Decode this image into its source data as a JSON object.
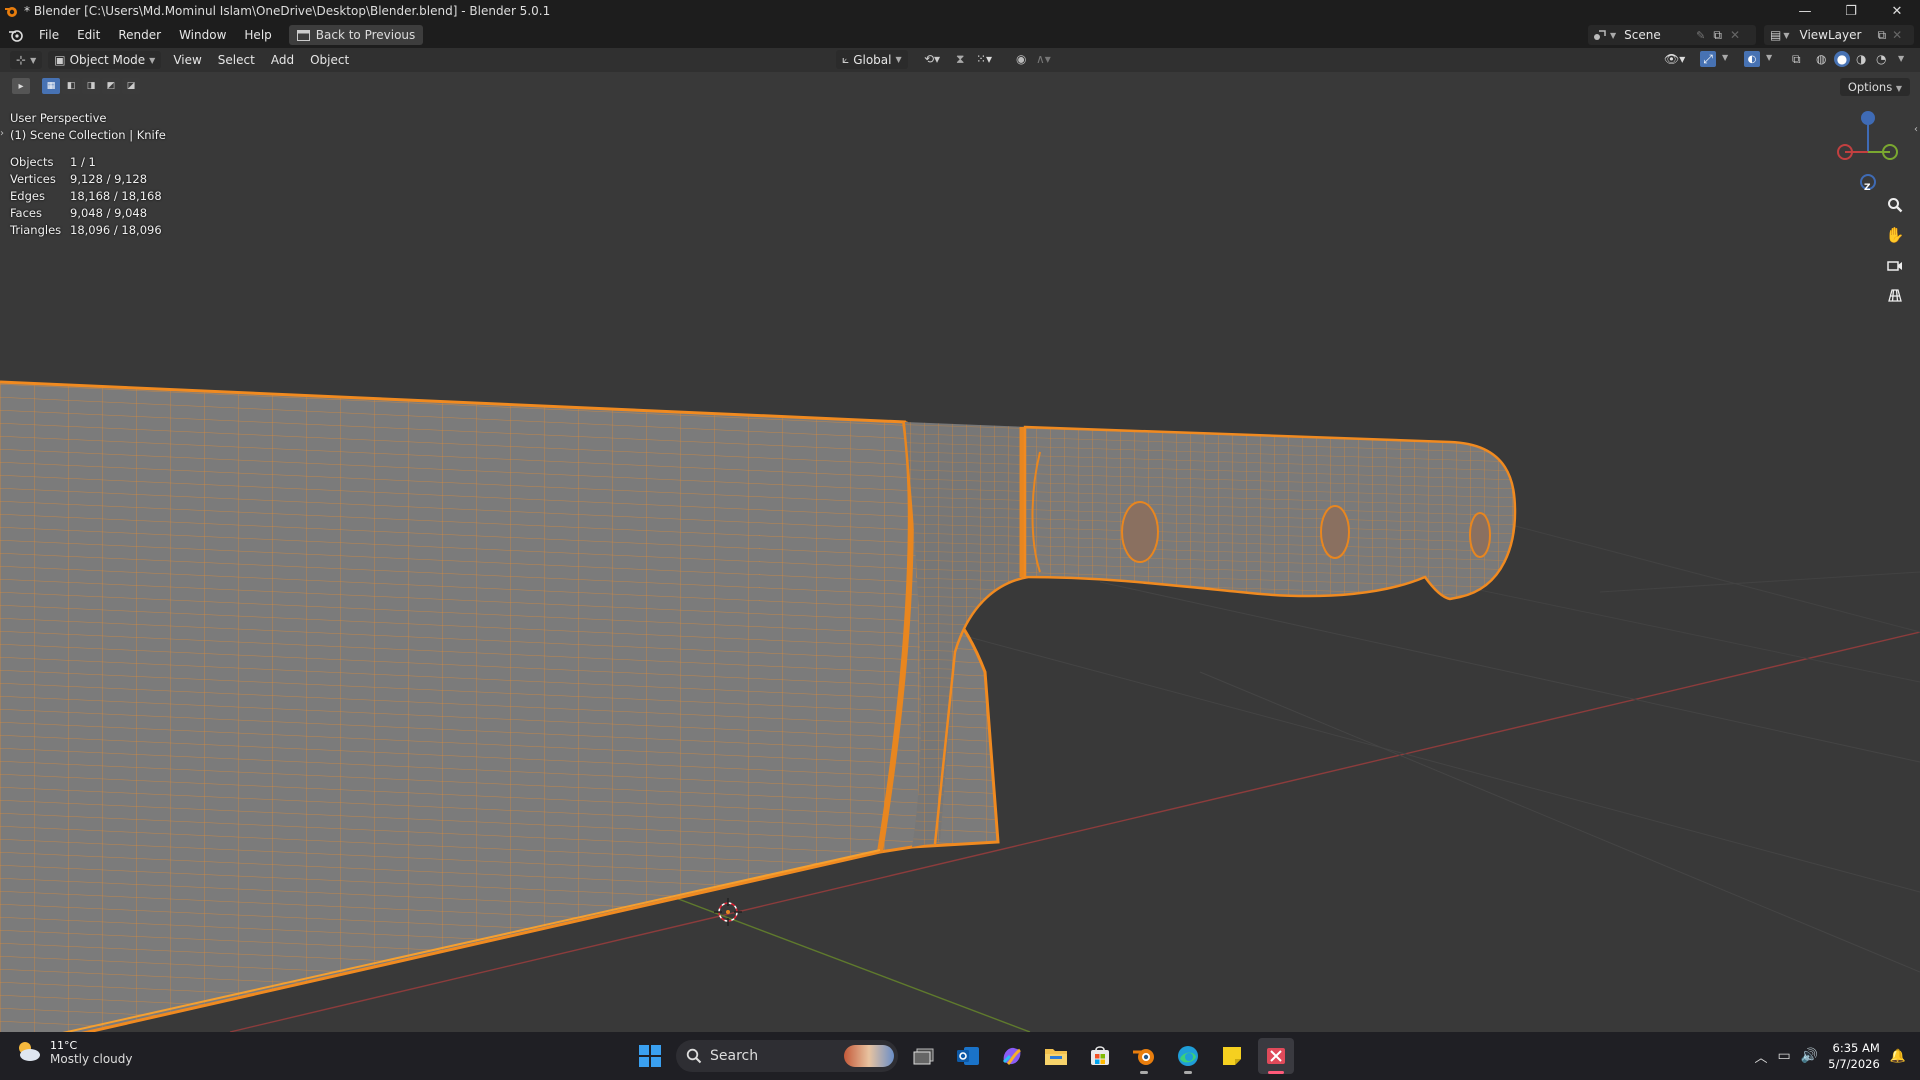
{
  "window": {
    "title": "* Blender [C:\\Users\\Md.Mominul Islam\\OneDrive\\Desktop\\Blender.blend] - Blender 5.0.1",
    "minimize": "—",
    "maximize": "❐",
    "close": "✕"
  },
  "menubar": {
    "items": [
      "File",
      "Edit",
      "Render",
      "Window",
      "Help"
    ],
    "back_button": "Back to Previous",
    "scene": "Scene",
    "view_layer": "ViewLayer"
  },
  "header": {
    "mode": "Object Mode",
    "menus": [
      "View",
      "Select",
      "Add",
      "Object"
    ],
    "transform_orientation": "Global"
  },
  "viewport": {
    "perspective": "User Perspective",
    "collection": "(1) Scene Collection | Knife",
    "options_label": "Options",
    "gizmo_z": "Z",
    "stats": [
      {
        "label": "Objects",
        "value": "1 / 1"
      },
      {
        "label": "Vertices",
        "value": "9,128 / 9,128"
      },
      {
        "label": "Edges",
        "value": "18,168 / 18,168"
      },
      {
        "label": "Faces",
        "value": "9,048 / 9,048"
      },
      {
        "label": "Triangles",
        "value": "18,096 / 18,096"
      }
    ],
    "colors": {
      "background": "#393939",
      "wire": "#e8892a",
      "mesh_face": "#7a7a7a",
      "x_axis": "#9b3a3a",
      "y_axis": "#6c8a32"
    }
  },
  "taskbar": {
    "temperature": "11°C",
    "weather": "Mostly cloudy",
    "search_label": "Search",
    "time": "6:35 AM",
    "date": "5/7/2026",
    "apps": [
      "windows-start",
      "task-view",
      "outlook",
      "copilot",
      "file-explorer",
      "microsoft-store",
      "blender",
      "edge",
      "sticky-notes",
      "snipping-tool"
    ]
  }
}
